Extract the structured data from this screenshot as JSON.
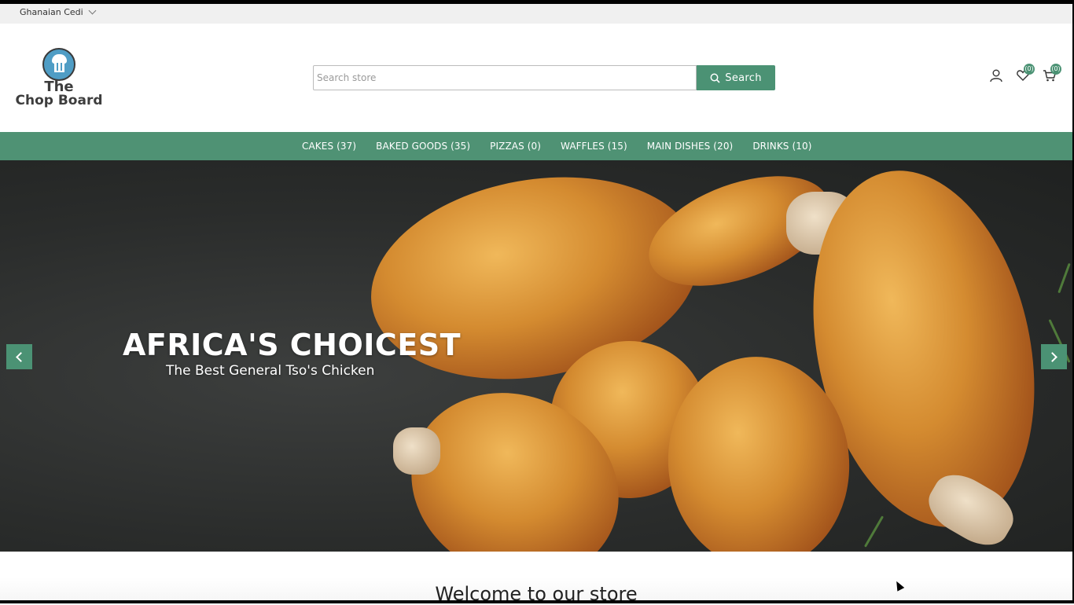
{
  "topbar": {
    "currency": "Ghanaian Cedi"
  },
  "header": {
    "logo_line1": "The",
    "logo_line2": "Chop Board",
    "search_placeholder": "Search store",
    "search_button": "Search",
    "wishlist_count": "(0)",
    "cart_count": "(0)"
  },
  "nav": {
    "items": [
      {
        "label": "CAKES (37)"
      },
      {
        "label": "BAKED GOODS (35)"
      },
      {
        "label": "PIZZAS (0)"
      },
      {
        "label": "WAFFLES (15)"
      },
      {
        "label": "MAIN DISHES (20)"
      },
      {
        "label": "DRINKS (10)"
      }
    ]
  },
  "hero": {
    "title": "AFRICA'S CHOICEST",
    "subtitle": "The Best General Tso's Chicken"
  },
  "welcome": {
    "heading": "Welcome to our store"
  },
  "colors": {
    "accent": "#4b9274",
    "nav_bg": "#4f9274",
    "topbar_bg": "#f0f0f0"
  }
}
